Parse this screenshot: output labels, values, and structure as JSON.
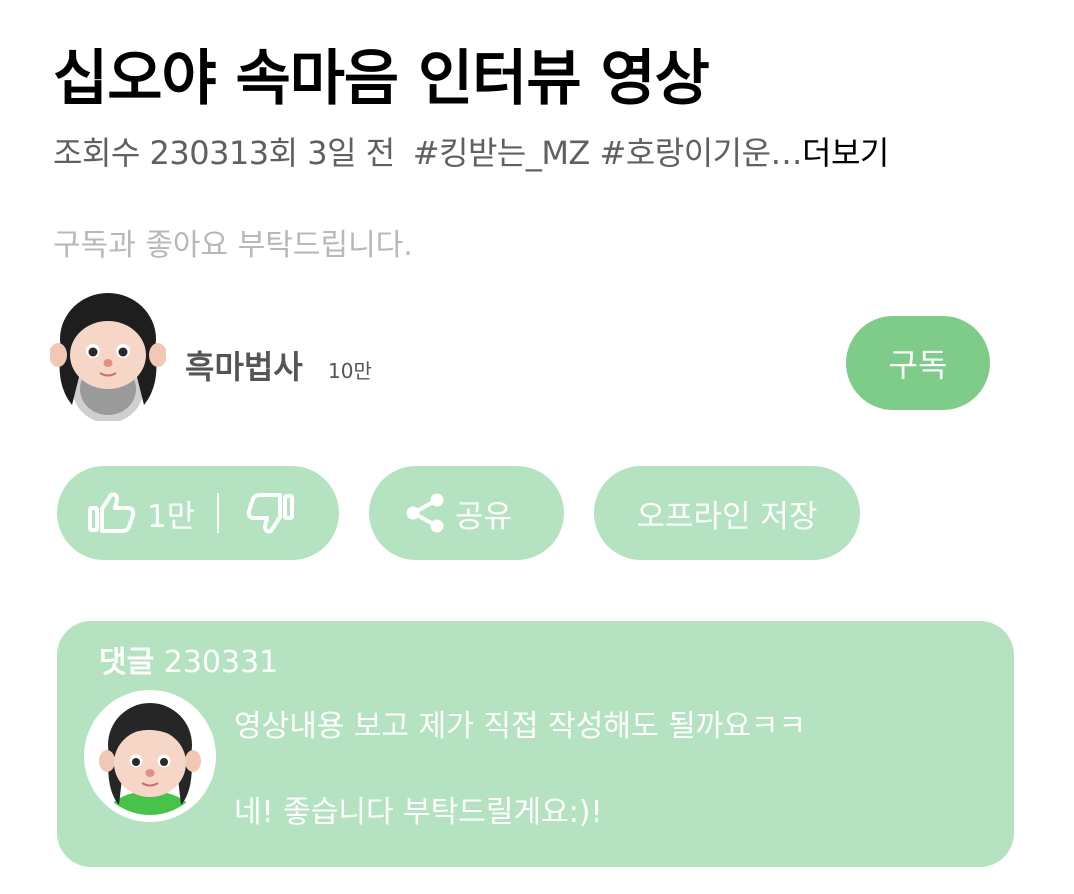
{
  "video": {
    "title": "십오야 속마음 인터뷰 영상",
    "views": "조회수 230313회",
    "age": "3일 전",
    "hashtags": "#킹받는_MZ #호랑이기운…",
    "more_label": "더보기",
    "description": "구독과 좋아요 부탁드립니다."
  },
  "channel": {
    "name": "흑마법사",
    "subscribers": "10만",
    "subscribe_label": "구독"
  },
  "actions": {
    "like_count": "1만",
    "share_label": "공유",
    "save_label": "오프라인 저장"
  },
  "comments": {
    "label": "댓글",
    "count": "230331",
    "top_comment": {
      "line1": "영상내용 보고 제가 직접 작성해도 될까요ㅋㅋ",
      "line2": "네! 좋습니다 부탁드릴게요:)!"
    }
  },
  "colors": {
    "subscribe_bg": "#7ecb8a",
    "pill_bg": "#b5e3c1",
    "title": "#000000",
    "meta": "#606060",
    "description": "#b8b8b8"
  },
  "icons": [
    "thumbs-up-icon",
    "thumbs-down-icon",
    "share-icon"
  ]
}
